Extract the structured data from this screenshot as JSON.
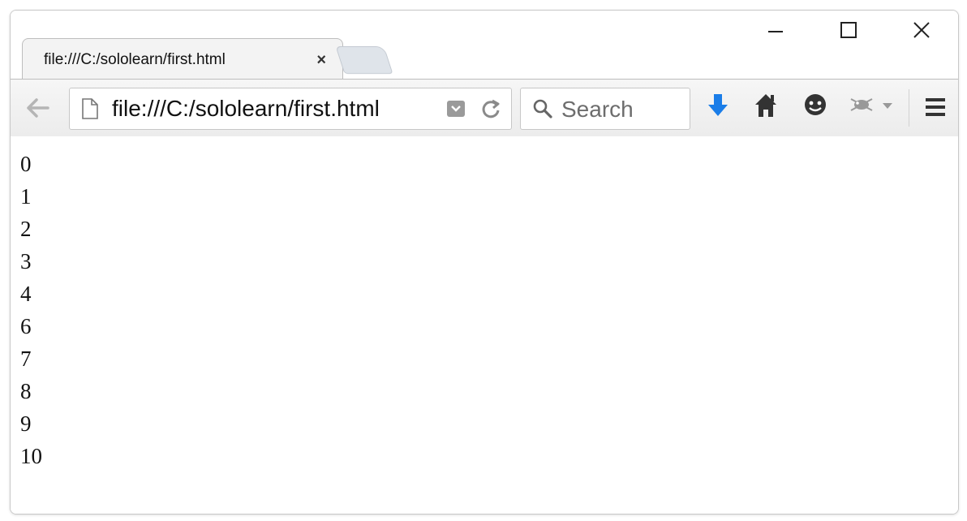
{
  "window": {
    "controls": {
      "minimize_icon": "minimize-icon",
      "maximize_icon": "maximize-icon",
      "close_icon": "close-icon"
    }
  },
  "tab": {
    "title": "file:///C:/sololearn/first.html",
    "close_label": "×"
  },
  "toolbar": {
    "url": "file:///C:/sololearn/first.html",
    "search_placeholder": "Search",
    "icons": [
      "back-arrow-icon",
      "page-icon",
      "reader-view-icon",
      "reload-icon",
      "search-icon",
      "download-icon",
      "home-icon",
      "chat-icon",
      "addon-icon",
      "chevron-down-icon",
      "hamburger-menu-icon"
    ],
    "accent": "#1a7de8"
  },
  "page": {
    "lines": [
      "0",
      "1",
      "2",
      "3",
      "4",
      "6",
      "7",
      "8",
      "9",
      "10"
    ]
  }
}
